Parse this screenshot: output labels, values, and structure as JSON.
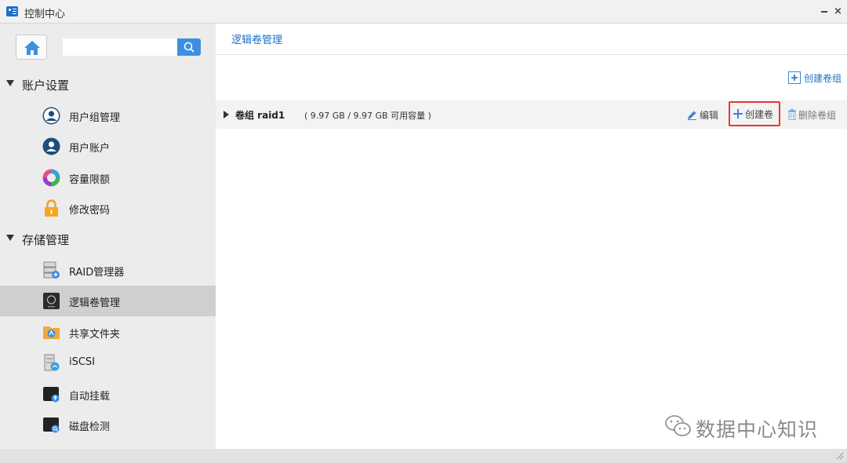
{
  "window": {
    "title": "控制中心",
    "app_icon": "control-panel-icon",
    "minimize_icon": "minimize-icon",
    "close_label": "×"
  },
  "sidebar": {
    "home_icon": "home-icon",
    "search": {
      "value": "",
      "placeholder": ""
    },
    "search_icon": "search-icon",
    "sections": [
      {
        "label": "账户设置",
        "items": [
          {
            "label": "用户组管理",
            "icon": "user-group-icon"
          },
          {
            "label": "用户账户",
            "icon": "user-account-icon"
          },
          {
            "label": "容量限额",
            "icon": "quota-icon"
          },
          {
            "label": "修改密码",
            "icon": "lock-icon"
          }
        ]
      },
      {
        "label": "存储管理",
        "items": [
          {
            "label": "RAID管理器",
            "icon": "raid-icon"
          },
          {
            "label": "逻辑卷管理",
            "icon": "lvm-icon",
            "active": true
          },
          {
            "label": "共享文件夹",
            "icon": "shared-folder-icon"
          },
          {
            "label": "iSCSI",
            "icon": "iscsi-icon"
          },
          {
            "label": "自动挂载",
            "icon": "automount-icon"
          },
          {
            "label": "磁盘检测",
            "icon": "disk-check-icon"
          }
        ]
      }
    ]
  },
  "main": {
    "page_title": "逻辑卷管理",
    "create_group_label": "创建卷组",
    "volume_groups": [
      {
        "name": "卷组  raid1",
        "capacity": "( 9.97 GB / 9.97 GB 可用容量 )",
        "actions": {
          "edit": "编辑",
          "create_volume": "创建卷",
          "delete_group": "删除卷组"
        }
      }
    ]
  },
  "watermark": {
    "text": "数据中心知识",
    "icon": "wechat-icon"
  },
  "colors": {
    "accent": "#1a73c8",
    "search_button": "#3d8fe0",
    "highlight_border": "#e53a35",
    "sidebar_bg": "#ececec",
    "active_item_bg": "#cfcfcf"
  }
}
